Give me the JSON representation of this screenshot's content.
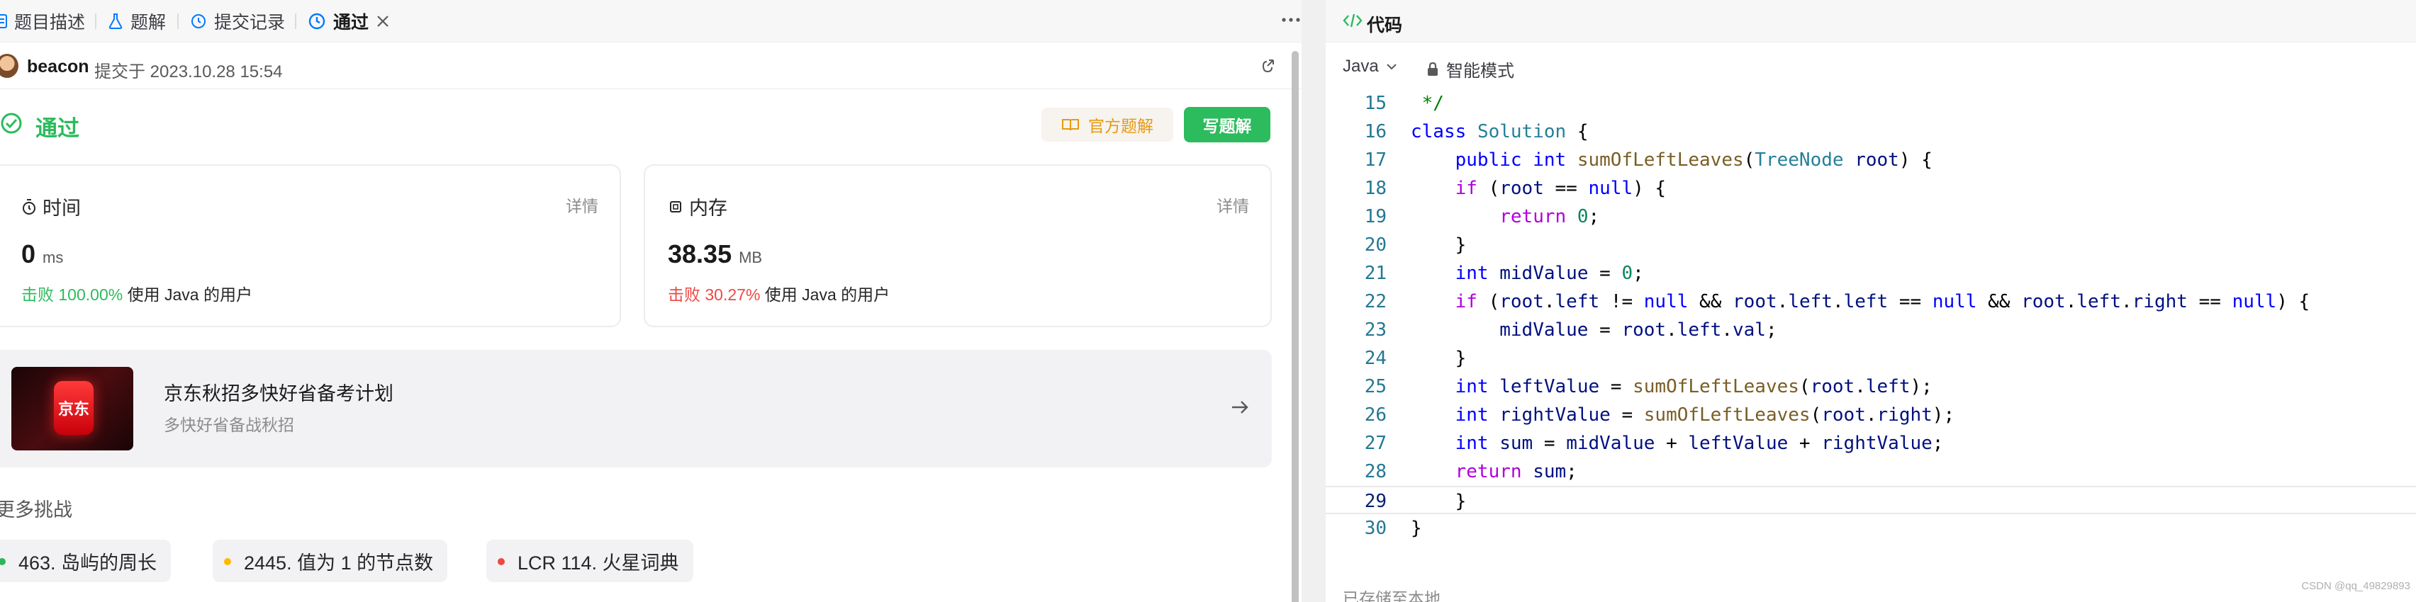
{
  "left_tabs": {
    "description": "题目描述",
    "solutions": "题解",
    "submissions": "提交记录",
    "passed": "通过"
  },
  "submission": {
    "user": "beacon",
    "submitted_at": "提交于 2023.10.28 15:54"
  },
  "result": {
    "status": "通过",
    "official_solution_label": "官方题解",
    "write_solution_label": "写题解"
  },
  "runtime": {
    "title": "时间",
    "detail": "详情",
    "value": "0",
    "unit": "ms",
    "beat_prefix": "击败",
    "beat_percent": "100.00%",
    "beat_suffix": "使用 Java 的用户"
  },
  "memory": {
    "title": "内存",
    "detail": "详情",
    "value": "38.35",
    "unit": "MB",
    "beat_prefix": "击败",
    "beat_percent": "30.27%",
    "beat_suffix": "使用 Java 的用户"
  },
  "promo": {
    "logo_text": "京东",
    "title": "京东秋招多快好省备考计划",
    "subtitle": "多快好省备战秋招"
  },
  "more_challenges": {
    "title": "更多挑战",
    "items": [
      {
        "label": "463. 岛屿的周长",
        "color": "#2db55d"
      },
      {
        "label": "2445. 值为 1 的节点数",
        "color": "#ffb800"
      },
      {
        "label": "LCR 114. 火星词典",
        "color": "#ef4743"
      }
    ]
  },
  "code_panel": {
    "title": "代码",
    "language": "Java",
    "mode": "智能模式",
    "footer": "已存储至本地",
    "active_line": "29",
    "lines": [
      {
        "n": "15",
        "text": " */"
      },
      {
        "n": "16",
        "text": "class Solution {"
      },
      {
        "n": "17",
        "text": "    public int sumOfLeftLeaves(TreeNode root) {"
      },
      {
        "n": "18",
        "text": "    if (root == null) {"
      },
      {
        "n": "19",
        "text": "        return 0;"
      },
      {
        "n": "20",
        "text": "    }"
      },
      {
        "n": "21",
        "text": "    int midValue = 0;"
      },
      {
        "n": "22",
        "text": "    if (root.left != null && root.left.left == null && root.left.right == null) {"
      },
      {
        "n": "23",
        "text": "        midValue = root.left.val;"
      },
      {
        "n": "24",
        "text": "    }"
      },
      {
        "n": "25",
        "text": "    int leftValue = sumOfLeftLeaves(root.left);"
      },
      {
        "n": "26",
        "text": "    int rightValue = sumOfLeftLeaves(root.right);"
      },
      {
        "n": "27",
        "text": "    int sum = midValue + leftValue + rightValue;"
      },
      {
        "n": "28",
        "text": "    return sum;"
      },
      {
        "n": "29",
        "text": "    }"
      },
      {
        "n": "30",
        "text": "}"
      }
    ]
  },
  "watermark": "CSDN @qq_49829893"
}
